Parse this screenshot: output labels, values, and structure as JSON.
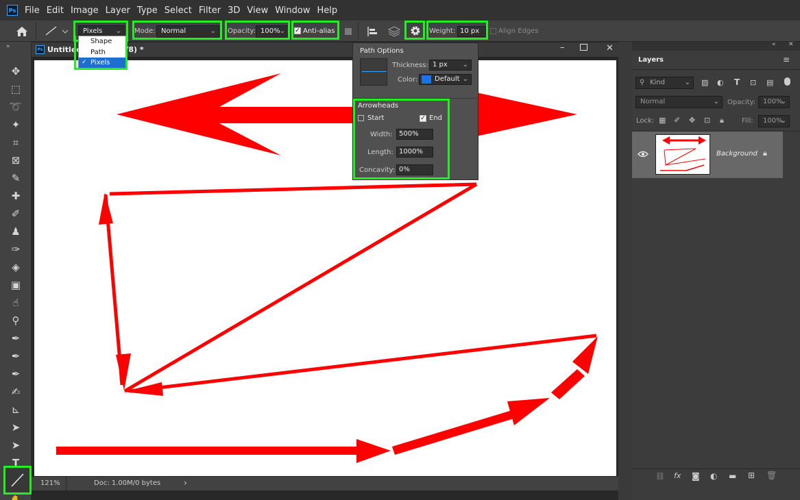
{
  "app": {
    "logo": "Ps"
  },
  "menu": [
    "File",
    "Edit",
    "Image",
    "Layer",
    "Type",
    "Select",
    "Filter",
    "3D",
    "View",
    "Window",
    "Help"
  ],
  "options_bar": {
    "tool_mode": "Pixels",
    "mode_label": "Mode:",
    "mode_value": "Normal",
    "opacity_label": "Opacity:",
    "opacity_value": "100%",
    "antialias_label": "Anti-alias",
    "weight_label": "Weight:",
    "weight_value": "10 px",
    "align_edges_label": "Align Edges"
  },
  "tool_mode_dropdown": {
    "items": [
      "Shape",
      "Path",
      "Pixels"
    ],
    "selected": "Pixels",
    "selected_color": "#1c6fd1"
  },
  "document": {
    "tab_title_start": "Untitled",
    "tab_title_end": "B/8) *",
    "zoom": "121%",
    "doc_info": "Doc: 1.00M/0 bytes",
    "arrow_color": "#ff0000"
  },
  "path_options": {
    "title": "Path Options",
    "thickness_label": "Thickness:",
    "thickness_value": "1 px",
    "color_label": "Color:",
    "color_value": "Default",
    "color_swatch": "#1a73e8",
    "arrowheads_title": "Arrowheads",
    "start_label": "Start",
    "start_checked": false,
    "end_label": "End",
    "end_checked": true,
    "width_label": "Width:",
    "width_value": "500%",
    "length_label": "Length:",
    "length_value": "1000%",
    "concavity_label": "Concavity:",
    "concavity_value": "0%"
  },
  "layers_panel": {
    "title": "Layers",
    "kind_placeholder": "Kind",
    "blend_mode": "Normal",
    "opacity_label": "Opacity:",
    "opacity_value": "100%",
    "lock_label": "Lock:",
    "fill_label": "Fill:",
    "fill_value": "100%",
    "layers": [
      {
        "name": "Background",
        "visible": true,
        "locked": true
      }
    ]
  },
  "colors": {
    "highlight": "#22ee22",
    "accent": "#31a8ff"
  }
}
